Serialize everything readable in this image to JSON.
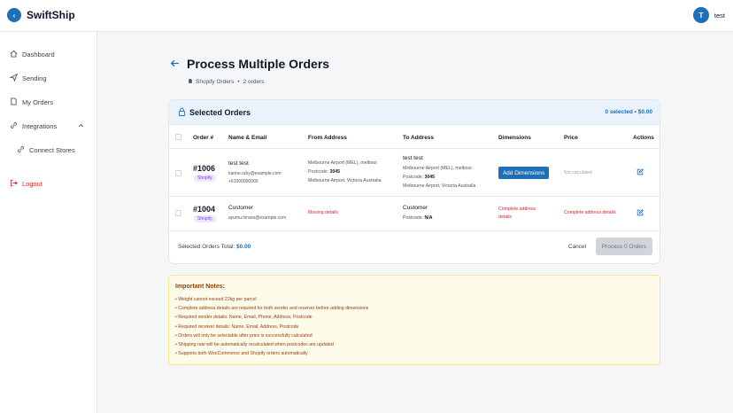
{
  "header": {
    "logo_letter": "‹",
    "app_name": "SwiftShip",
    "avatar_letter": "T",
    "user_name": "test"
  },
  "sidebar": {
    "items": [
      {
        "label": "Dashboard",
        "icon": "home-icon"
      },
      {
        "label": "Sending",
        "icon": "send-icon"
      },
      {
        "label": "My Orders",
        "icon": "document-icon"
      },
      {
        "label": "Integrations",
        "icon": "link-icon"
      },
      {
        "label": "Connect Stores",
        "icon": "link-icon"
      },
      {
        "label": "Logout",
        "icon": "logout-icon"
      }
    ]
  },
  "page": {
    "title": "Process Multiple Orders",
    "source": "Shopify Orders",
    "count": "2 orders"
  },
  "card": {
    "title": "Selected Orders",
    "selected_summary": "0 selected • $0.00",
    "columns": [
      "Order #",
      "Name & Email",
      "From Address",
      "To Address",
      "Dimensions",
      "Price",
      "Actions"
    ],
    "rows": [
      {
        "order_no": "#1006",
        "platform": "Shopify",
        "name": "test test",
        "email": "karine.ruby@example.com",
        "phone": "+61000000000",
        "from_line1": "Melbourne Airport (MEL), melbour",
        "from_postcode_label": "Postcode:",
        "from_postcode": "3045",
        "from_line3": "Melbourne Airport, Victoria Australia",
        "to_name": "test test",
        "to_line1": "Melbourne Airport (MEL), melbour",
        "to_postcode_label": "Postcode:",
        "to_postcode": "3045",
        "to_line3": "Melbourne Airport, Victoria Australia",
        "dimensions_button": "Add Dimensions",
        "price": "Not calculated"
      },
      {
        "order_no": "#1004",
        "platform": "Shopify",
        "name": "Customer",
        "email": "ayumu.hirano@example.com",
        "from_status": "Missing details",
        "to_name": "Customer",
        "to_postcode_label": "Postcode:",
        "to_postcode": "N/A",
        "dimensions_line1": "Complete address",
        "dimensions_line2": "details",
        "price": "Complete address details"
      }
    ],
    "footer": {
      "total_label": "Selected Orders Total:",
      "total_value": "$0.00",
      "cancel_label": "Cancel",
      "process_label": "Process 0 Orders"
    }
  },
  "notes": {
    "title": "Important Notes:",
    "items": [
      "• Weight cannot exceed 22kg per parcel",
      "• Complete address details are required for both sender and receiver before adding dimensions",
      "• Required sender details: Name, Email, Phone, Address, Postcode",
      "• Required receiver details: Name, Email, Address, Postcode",
      "• Orders will only be selectable after price is successfully calculated",
      "• Shipping rate will be automatically recalculated when postcodes are updated",
      "• Supports both WooCommerce and Shopify orders automatically"
    ]
  },
  "colors": {
    "accent": "#1e6fb8",
    "error": "#dc2626",
    "notes_bg": "#fffbeb",
    "notes_text": "#92400e"
  }
}
